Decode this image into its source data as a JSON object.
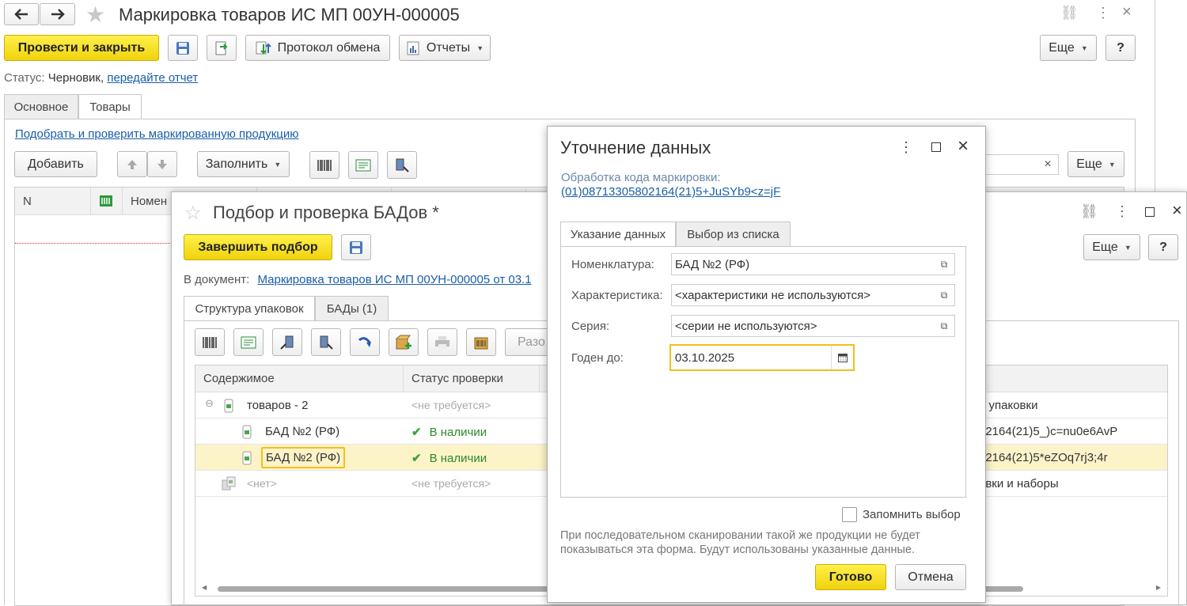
{
  "main_window": {
    "title": "Маркировка товаров ИС МП 00УН-000005",
    "toolbar": {
      "post_close": "Провести и закрыть",
      "exchange_log": "Протокол обмена",
      "reports": "Отчеты",
      "more": "Еще",
      "help": "?"
    },
    "status_label": "Статус:",
    "status_value": "Черновик,",
    "status_link": "передайте отчет",
    "tabs": [
      "Основное",
      "Товары"
    ],
    "pick_link": "Подобрать и проверить маркированную продукцию",
    "add": "Добавить",
    "fill": "Заполнить",
    "more2": "Еще",
    "table_cols": [
      "N",
      "Номен"
    ]
  },
  "pick_window": {
    "title": "Подбор и проверка БАДов *",
    "finish": "Завершить подбор",
    "doc_label": "В документ:",
    "doc_link": "Маркировка товаров ИС МП 00УН-000005 от 03.1",
    "more": "Еще",
    "help": "?",
    "tabs": [
      "Структура упаковок",
      "БАДы (1)"
    ],
    "cut_btn": "Разо",
    "columns": [
      "Содержимое",
      "Статус проверки"
    ],
    "rows": [
      {
        "content": "товаров - 2",
        "status": "<не требуется>",
        "right": "е упаковки"
      },
      {
        "content": "БАД №2 (РФ)",
        "status": "В наличии",
        "right": "02164(21)5_)c=nu0e6AvP"
      },
      {
        "content": "БАД №2 (РФ)",
        "status": "В наличии",
        "right": "02164(21)5*eZOq7rj3;4r"
      },
      {
        "content": "<нет>",
        "status": "<не требуется>",
        "right": "овки и наборы"
      }
    ]
  },
  "dialog": {
    "title": "Уточнение данных",
    "processing_label": "Обработка кода маркировки:",
    "code_link": "(01)08713305802164(21)5+JuSYb9<z=jF",
    "tabs": [
      "Указание данных",
      "Выбор из списка"
    ],
    "fields": {
      "nomenclature_label": "Номенклатура:",
      "nomenclature_value": "БАД №2 (РФ)",
      "characteristic_label": "Характеристика:",
      "characteristic_value": "<характеристики не используются>",
      "series_label": "Серия:",
      "series_value": "<серии не используются>",
      "expiry_label": "Годен до:",
      "expiry_value": "03.10.2025"
    },
    "remember": "Запомнить выбор",
    "note_line1": "При последовательном сканировании такой же продукции не будет",
    "note_line2": "показываться эта форма. Будут использованы указанные данные.",
    "ok": "Готово",
    "cancel": "Отмена"
  },
  "colors": {
    "accent_yellow": "#f5dc1e",
    "link_blue": "#1a5ea8",
    "selected_row": "#fdf3c9",
    "check_green": "#3aa63a"
  }
}
